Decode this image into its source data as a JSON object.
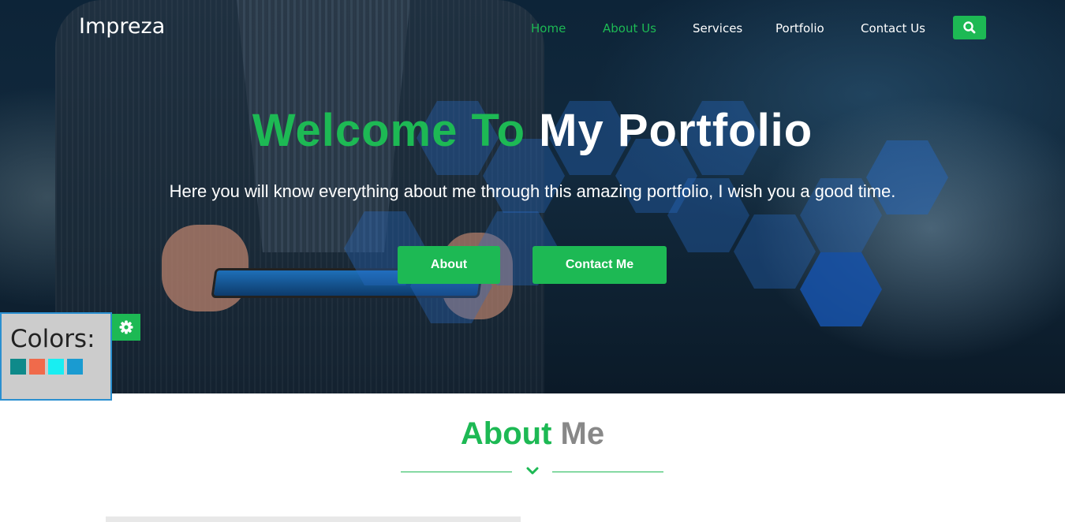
{
  "nav": {
    "brand": "Impreza",
    "items": [
      {
        "label": "Home",
        "active": true
      },
      {
        "label": "About Us",
        "active": true
      },
      {
        "label": "Services",
        "active": false
      },
      {
        "label": "Portfolio",
        "active": false
      },
      {
        "label": "Contact Us",
        "active": false
      }
    ],
    "search_icon": "search-icon"
  },
  "hero": {
    "title_green": "Welcome To",
    "title_white": "My Portfolio",
    "subtitle": "Here you will know everything about me through this amazing portfolio, I wish you a good time.",
    "buttons": {
      "about": "About",
      "contact": "Contact Me"
    }
  },
  "colors_panel": {
    "title": "Colors:",
    "gear_icon": "gear-icon",
    "swatches": [
      "#0e8a8a",
      "#f06a4b",
      "#18eef2",
      "#1a9bd1"
    ]
  },
  "about": {
    "title_green": "About",
    "title_gray": "Me",
    "divider_icon": "chevron-down-icon"
  },
  "colors": {
    "accent": "#1db954",
    "white": "#ffffff",
    "gray": "#888888"
  }
}
